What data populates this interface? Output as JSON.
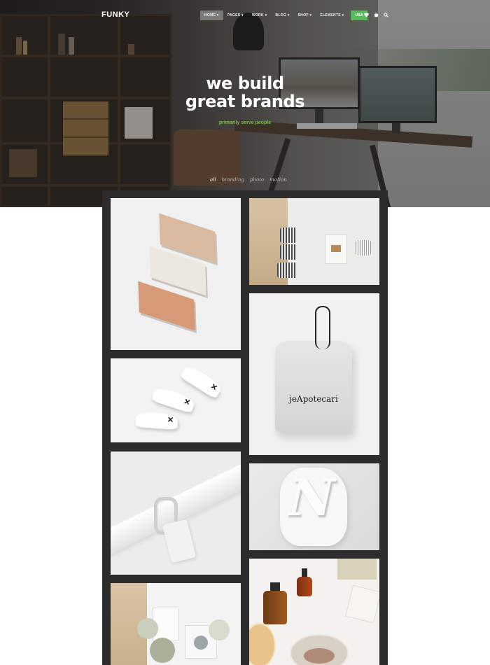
{
  "brand": {
    "logo": "FUNKY"
  },
  "nav": {
    "items": [
      {
        "label": "HOME ▾"
      },
      {
        "label": "PAGES ▾"
      },
      {
        "label": "WORK ▾"
      },
      {
        "label": "BLOG ▾"
      },
      {
        "label": "SHOP ▾"
      },
      {
        "label": "ELEMENTS ▾"
      }
    ],
    "language": "USA",
    "icons": [
      "heart-icon",
      "cart-icon",
      "search-icon"
    ],
    "language_color": "#5cb85c"
  },
  "hero": {
    "headline_line1": "we build",
    "headline_line2": "great brands",
    "tagline": "primarily serve people",
    "tagline_color": "#7bc043"
  },
  "filters": [
    {
      "label": "all"
    },
    {
      "label": "branding"
    },
    {
      "label": "photo"
    },
    {
      "label": "motion"
    }
  ],
  "portfolio": {
    "items": [
      {
        "subject": "books"
      },
      {
        "subject": "mugs"
      },
      {
        "subject": "sneakers"
      },
      {
        "subject": "drawstring-bag",
        "brand_text": "jeApotecari"
      },
      {
        "subject": "bracket"
      },
      {
        "subject": "letter-n"
      },
      {
        "subject": "oil-bottles"
      },
      {
        "subject": "mirrors"
      }
    ]
  }
}
